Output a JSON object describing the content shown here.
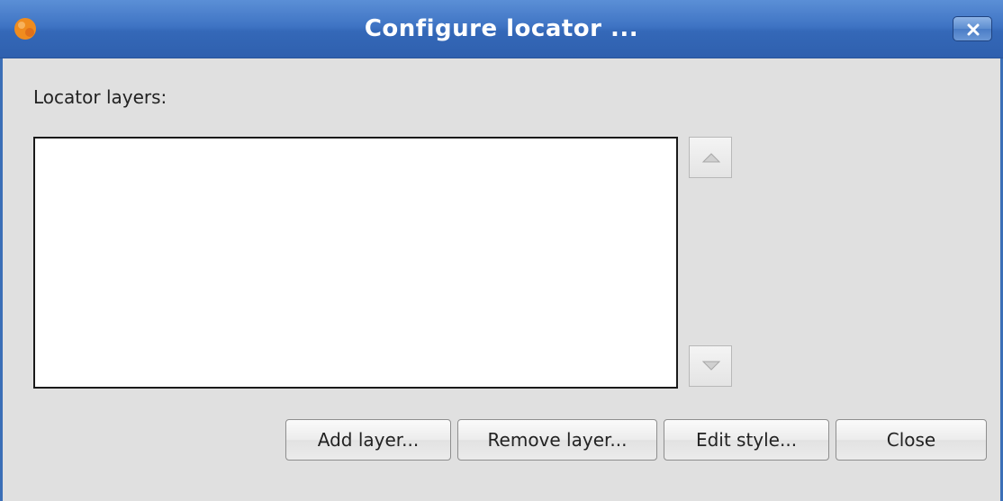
{
  "window": {
    "title": "Configure locator ...",
    "icon": "app-logo-icon",
    "close_icon": "close-icon"
  },
  "main": {
    "layers_label": "Locator layers:",
    "layers": [],
    "move_up_icon": "triangle-up-icon",
    "move_down_icon": "triangle-down-icon"
  },
  "buttons": {
    "add_label": "Add layer...",
    "remove_label": "Remove layer...",
    "edit_label": "Edit style...",
    "close_label": "Close"
  },
  "colors": {
    "titlebar": "#3f74c4",
    "window_bg": "#e0e0e0",
    "accent_icon": "#f08c1e"
  }
}
